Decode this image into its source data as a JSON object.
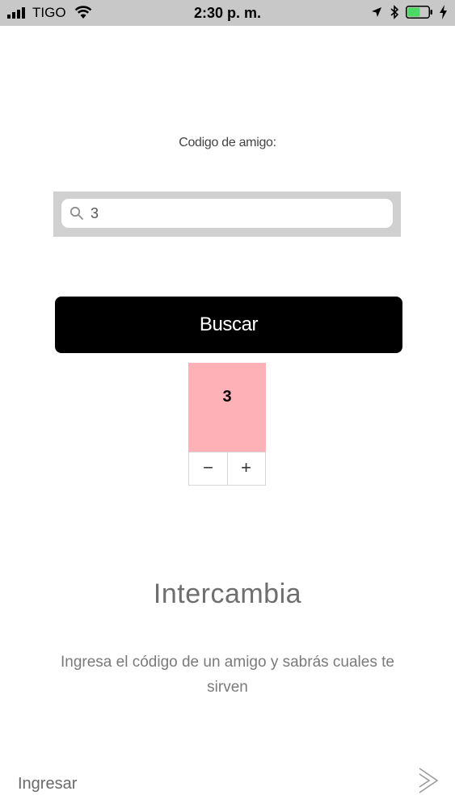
{
  "status_bar": {
    "carrier": "TIGO",
    "time": "2:30 p. m.",
    "battery_level": 0.6,
    "battery_color": "#4cd964",
    "icons": [
      "signal-icon",
      "wifi-icon",
      "location-arrow-icon",
      "bluetooth-icon",
      "battery-icon",
      "charging-bolt-icon"
    ]
  },
  "friend_search": {
    "label": "Codigo de amigo:",
    "value": "3",
    "button_label": "Buscar"
  },
  "stepper": {
    "value": "3",
    "minus_label": "−",
    "plus_label": "+",
    "accent": "#ffb1b8"
  },
  "intro": {
    "title": "Intercambia",
    "description": "Ingresa el código de un amigo y sabrás cuales te sirven"
  },
  "footer": {
    "login_label": "Ingresar",
    "next_icon": "chevron-right-icon"
  }
}
